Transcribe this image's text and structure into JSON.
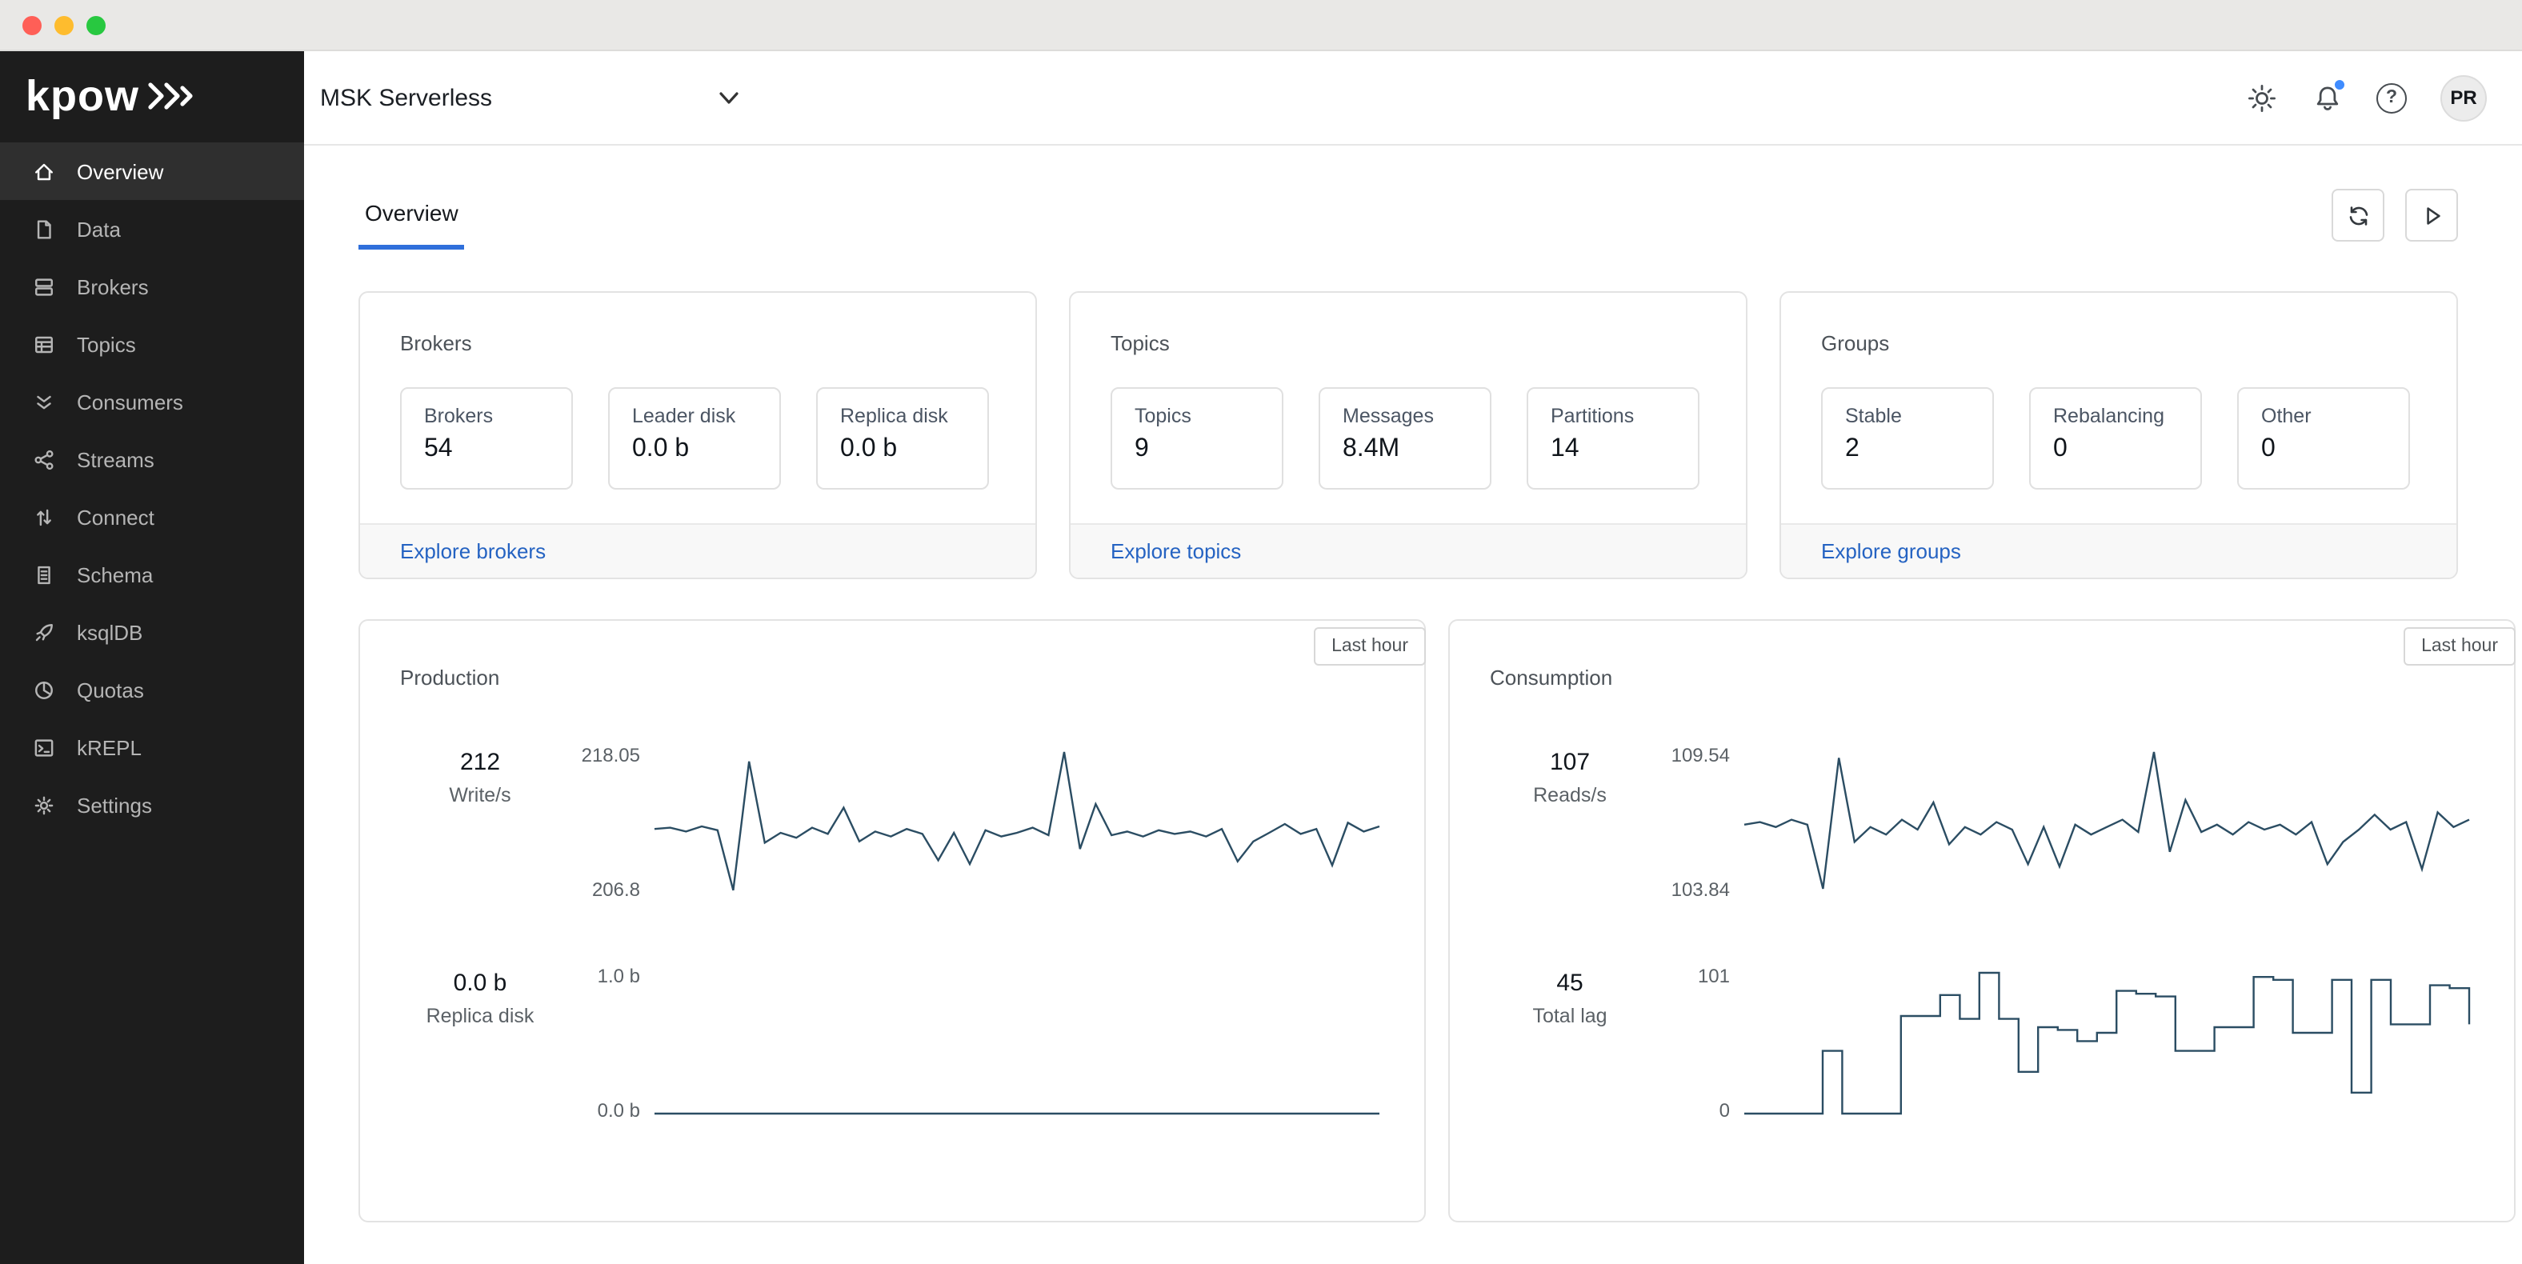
{
  "theme": {
    "accent_blue": "#2563c2",
    "tab_underline": "#2f6fdb",
    "chart_line": "#2b4d63",
    "notification_dot": "#3f8cff",
    "traffic_red": "#ff5f57",
    "traffic_yellow": "#febc2e",
    "traffic_green": "#28c840"
  },
  "sidebar": {
    "logo_text": "kpow",
    "items": [
      {
        "label": "Overview",
        "icon": "home-icon",
        "active": true
      },
      {
        "label": "Data",
        "icon": "document-icon",
        "active": false
      },
      {
        "label": "Brokers",
        "icon": "server-icon",
        "active": false
      },
      {
        "label": "Topics",
        "icon": "table-icon",
        "active": false
      },
      {
        "label": "Consumers",
        "icon": "double-chevron-down-icon",
        "active": false
      },
      {
        "label": "Streams",
        "icon": "share-icon",
        "active": false
      },
      {
        "label": "Connect",
        "icon": "swap-arrows-icon",
        "active": false
      },
      {
        "label": "Schema",
        "icon": "schema-document-icon",
        "active": false
      },
      {
        "label": "ksqlDB",
        "icon": "rocket-icon",
        "active": false
      },
      {
        "label": "Quotas",
        "icon": "pie-chart-icon",
        "active": false
      },
      {
        "label": "kREPL",
        "icon": "terminal-icon",
        "active": false
      },
      {
        "label": "Settings",
        "icon": "gear-icon",
        "active": false
      }
    ]
  },
  "header": {
    "cluster_selector": "MSK Serverless",
    "avatar_initials": "PR",
    "help_glyph": "?"
  },
  "tabs": {
    "overview": "Overview"
  },
  "summary_cards": [
    {
      "title": "Brokers",
      "link": "Explore brokers",
      "stats": [
        {
          "label": "Brokers",
          "value": "54"
        },
        {
          "label": "Leader disk",
          "value": "0.0 b"
        },
        {
          "label": "Replica disk",
          "value": "0.0 b"
        }
      ]
    },
    {
      "title": "Topics",
      "link": "Explore topics",
      "stats": [
        {
          "label": "Topics",
          "value": "9"
        },
        {
          "label": "Messages",
          "value": "8.4M"
        },
        {
          "label": "Partitions",
          "value": "14"
        }
      ]
    },
    {
      "title": "Groups",
      "link": "Explore groups",
      "stats": [
        {
          "label": "Stable",
          "value": "2"
        },
        {
          "label": "Rebalancing",
          "value": "0"
        },
        {
          "label": "Other",
          "value": "0"
        }
      ]
    }
  ],
  "chart_cards": [
    {
      "title": "Production",
      "range_badge": "Last hour",
      "rows": [
        {
          "metric_value": "212",
          "metric_label": "Write/s",
          "axis_top": "218.05",
          "axis_bottom": "206.8",
          "series": "production_writes"
        },
        {
          "metric_value": "0.0 b",
          "metric_label": "Replica disk",
          "axis_top": "1.0 b",
          "axis_bottom": "0.0 b",
          "series": "production_replica"
        }
      ]
    },
    {
      "title": "Consumption",
      "range_badge": "Last hour",
      "rows": [
        {
          "metric_value": "107",
          "metric_label": "Reads/s",
          "axis_top": "109.54",
          "axis_bottom": "103.84",
          "series": "consumption_reads"
        },
        {
          "metric_value": "45",
          "metric_label": "Total lag",
          "axis_top": "101",
          "axis_bottom": "0",
          "series": "consumption_lag"
        }
      ]
    }
  ],
  "chart_data": {
    "production_writes": {
      "type": "line",
      "min": 206.8,
      "max": 218.05,
      "values": [
        211.9,
        212.0,
        211.7,
        212.1,
        211.8,
        207.0,
        217.3,
        210.8,
        211.6,
        211.2,
        212.0,
        211.5,
        213.6,
        210.9,
        211.7,
        211.3,
        211.9,
        211.5,
        209.4,
        211.6,
        209.1,
        211.8,
        211.3,
        211.6,
        212.0,
        211.4,
        218.05,
        210.3,
        213.9,
        211.4,
        211.7,
        211.3,
        211.8,
        211.5,
        211.7,
        211.3,
        211.9,
        209.3,
        210.9,
        211.6,
        212.3,
        211.5,
        211.9,
        209.0,
        212.4,
        211.7,
        212.1
      ]
    },
    "production_replica": {
      "type": "line",
      "min": 0,
      "max": 1,
      "values": [
        0,
        0,
        0,
        0,
        0,
        0,
        0,
        0,
        0,
        0
      ]
    },
    "consumption_reads": {
      "type": "line",
      "min": 103.84,
      "max": 109.54,
      "values": [
        106.6,
        106.7,
        106.5,
        106.8,
        106.6,
        104.0,
        109.3,
        105.9,
        106.5,
        106.2,
        106.8,
        106.4,
        107.5,
        105.8,
        106.5,
        106.2,
        106.7,
        106.4,
        105.0,
        106.5,
        104.9,
        106.6,
        106.2,
        106.5,
        106.8,
        106.3,
        109.54,
        105.5,
        107.6,
        106.3,
        106.6,
        106.2,
        106.7,
        106.4,
        106.6,
        106.2,
        106.7,
        105.0,
        105.9,
        106.4,
        107.0,
        106.4,
        106.7,
        104.8,
        107.1,
        106.5,
        106.8
      ]
    },
    "consumption_lag": {
      "type": "step",
      "min": 0,
      "max": 101,
      "values": [
        0,
        0,
        0,
        0,
        45,
        0,
        0,
        0,
        70,
        70,
        85,
        68,
        101,
        68,
        30,
        62,
        60,
        52,
        58,
        88,
        86,
        84,
        45,
        45,
        62,
        62,
        98,
        96,
        58,
        58,
        96,
        15,
        96,
        64,
        64,
        92,
        90,
        64
      ]
    }
  }
}
